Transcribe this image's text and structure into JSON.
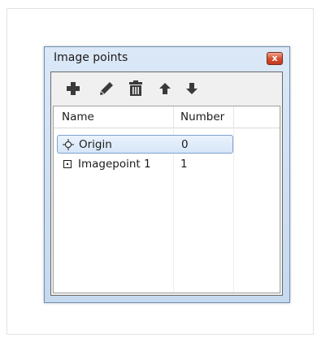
{
  "window": {
    "title": "Image points",
    "close_glyph": "x"
  },
  "toolbar": {
    "buttons": [
      {
        "name": "add",
        "icon": "plus-icon"
      },
      {
        "name": "edit",
        "icon": "pencil-icon"
      },
      {
        "name": "delete",
        "icon": "trash-icon"
      },
      {
        "name": "move-up",
        "icon": "arrow-up-icon"
      },
      {
        "name": "move-down",
        "icon": "arrow-down-icon"
      }
    ]
  },
  "table": {
    "columns": [
      "Name",
      "Number"
    ],
    "rows": [
      {
        "name": "Origin",
        "number": "0",
        "icon": "crosshair-icon",
        "selected": true
      },
      {
        "name": "Imagepoint 1",
        "number": "1",
        "icon": "square-point-icon",
        "selected": false
      }
    ]
  },
  "colors": {
    "title_gradient_top": "#dbe8f7",
    "title_gradient_bottom": "#c6d9ef",
    "close_button": "#d34a2b",
    "selection_border": "#7da2ce"
  }
}
